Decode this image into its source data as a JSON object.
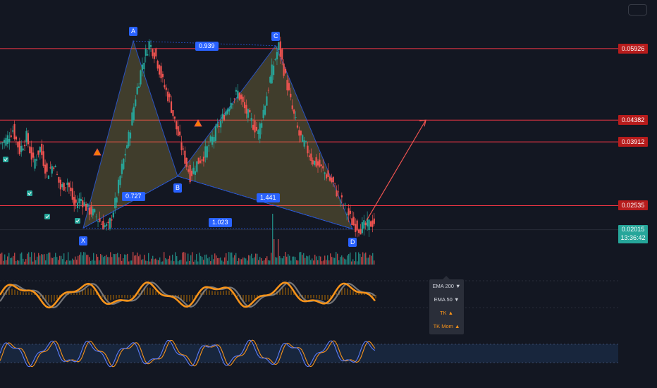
{
  "chart_data": {
    "type": "candlestick",
    "title": "",
    "xlabel": "",
    "ylabel": "",
    "ylim": [
      0.0175,
      0.0625
    ],
    "grid": false,
    "levels": [
      {
        "label": "0.05926",
        "value": 0.05926,
        "color": "#b71c1c"
      },
      {
        "label": "0.04382",
        "value": 0.04382,
        "color": "#b71c1c"
      },
      {
        "label": "0.03912",
        "value": 0.03912,
        "color": "#b71c1c"
      },
      {
        "label": "0.02535",
        "value": 0.02535,
        "color": "#b71c1c"
      }
    ],
    "current_price": {
      "label": "0.02015",
      "value": 0.02015,
      "countdown": "13:36:42",
      "color": "#26a69a"
    },
    "harmonic_pattern": {
      "points": [
        {
          "label": "X",
          "price": 0.0205
        },
        {
          "label": "A",
          "price": 0.0609
        },
        {
          "label": "B",
          "price": 0.0317
        },
        {
          "label": "C",
          "price": 0.0599
        },
        {
          "label": "D",
          "price": 0.0203
        }
      ],
      "ratios": [
        {
          "label": "0.727",
          "between": "XA-AB"
        },
        {
          "label": "0.939",
          "between": "AB-BC"
        },
        {
          "label": "1.441",
          "between": "BC-CD"
        },
        {
          "label": "1.023",
          "between": "XA-AD"
        }
      ],
      "projection_target": 0.04382
    },
    "close_series": [
      0.0395,
      0.0418,
      0.0372,
      0.0402,
      0.0345,
      0.0378,
      0.0322,
      0.0345,
      0.029,
      0.0305,
      0.0255,
      0.0268,
      0.0245,
      0.0235,
      0.0215,
      0.0205,
      0.0258,
      0.0335,
      0.0402,
      0.049,
      0.056,
      0.0605,
      0.0575,
      0.052,
      0.048,
      0.042,
      0.0365,
      0.0318,
      0.0345,
      0.0362,
      0.039,
      0.042,
      0.045,
      0.048,
      0.0498,
      0.0462,
      0.0435,
      0.041,
      0.0475,
      0.0545,
      0.0598,
      0.053,
      0.046,
      0.0405,
      0.038,
      0.035,
      0.0338,
      0.032,
      0.03,
      0.0268,
      0.024,
      0.0212,
      0.0205,
      0.0212,
      0.0218
    ],
    "indicators": [
      {
        "name": "EMA 200",
        "arrow": "▼",
        "color": "#d1d4dc"
      },
      {
        "name": "EMA 50",
        "arrow": "▼",
        "color": "#d1d4dc"
      },
      {
        "name": "TK",
        "arrow": "▲",
        "color": "#f7931a"
      },
      {
        "name": "TK Mom",
        "arrow": "▲",
        "color": "#f7931a"
      }
    ],
    "colors": {
      "up": "#26a69a",
      "down": "#ef5350",
      "pattern": "#2962ff",
      "fill": "#b7a148",
      "projection": "#ef5350",
      "level_line": "#f23645"
    }
  }
}
